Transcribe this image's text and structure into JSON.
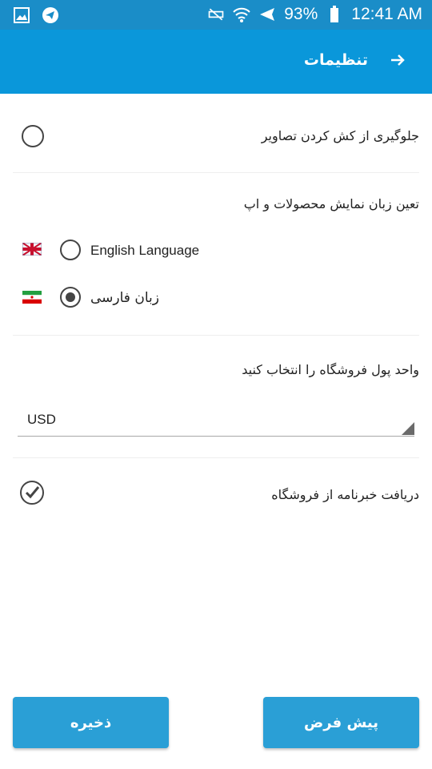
{
  "status_bar": {
    "battery": "93%",
    "time": "12:41 AM",
    "icons": [
      "gallery-icon",
      "telegram-icon",
      "mute-icon",
      "wifi-icon",
      "airplane-icon",
      "battery-icon"
    ]
  },
  "toolbar": {
    "title": "تنظیمات",
    "back_icon": "arrow-right-icon"
  },
  "settings": {
    "prevent_image_drag_label": "جلوگیری از کش کردن تصاویر",
    "prevent_image_drag_checked": false,
    "language_section_label": "تعین زبان نمایش محصولات و اپ",
    "languages": [
      {
        "label": "English Language",
        "flag": "uk-flag",
        "selected": false
      },
      {
        "label": "زبان فارسی",
        "flag": "iran-flag",
        "selected": true
      }
    ],
    "currency_section_label": "واحد پول فروشگاه را انتخاب کنید",
    "currency_value": "USD",
    "newsletter_label": "دریافت خبرنامه از فروشگاه",
    "newsletter_checked": true
  },
  "buttons": {
    "save_label": "ذخیره",
    "default_label": "پیش فرض"
  },
  "colors": {
    "status_bar": "#1a8dc8",
    "toolbar": "#0a97da",
    "button": "#2a9fd6"
  }
}
